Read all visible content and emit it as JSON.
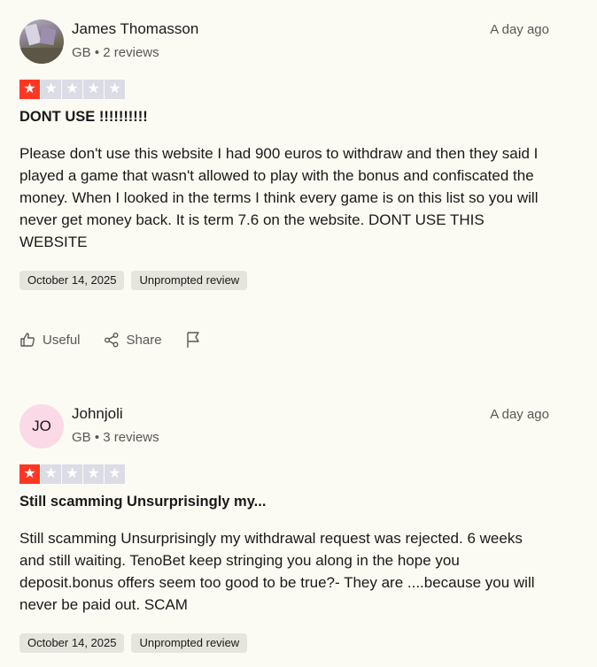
{
  "reviews": [
    {
      "reviewer": {
        "name": "James Thomasson",
        "meta": "GB • 2 reviews",
        "initials": ""
      },
      "when": "A day ago",
      "rating": 1,
      "title": "DONT USE !!!!!!!!!!",
      "body": "Please don't use this website I had 900 euros to withdraw and then they said I played a game that wasn't allowed to play with the bonus and confiscated the money. When I looked in the terms I think every game is on this list so you will never get money back. It is term 7.6 on the website. DONT USE THIS WEBSITE",
      "tags": {
        "date": "October 14, 2025",
        "type": "Unprompted review"
      },
      "actions": {
        "useful": "Useful",
        "share": "Share"
      }
    },
    {
      "reviewer": {
        "name": "Johnjoli",
        "meta": "GB • 3 reviews",
        "initials": "JO"
      },
      "when": "A day ago",
      "rating": 1,
      "title": "Still scamming Unsurprisingly my...",
      "body": "Still scamming Unsurprisingly my withdrawal request was rejected. 6 weeks and still waiting. TenoBet keep stringing you along in the hope you deposit.bonus offers seem too good to be true?- They are ....because you will never be paid out. SCAM",
      "tags": {
        "date": "October 14, 2025",
        "type": "Unprompted review"
      }
    }
  ],
  "colors": {
    "star_on": "#ff3722",
    "star_off": "#dcdce6",
    "background": "#fcfbf3",
    "avatar_jo": "#fbd9e6"
  },
  "icons": [
    "star-icon",
    "thumbs-up-icon",
    "share-icon",
    "flag-icon"
  ]
}
